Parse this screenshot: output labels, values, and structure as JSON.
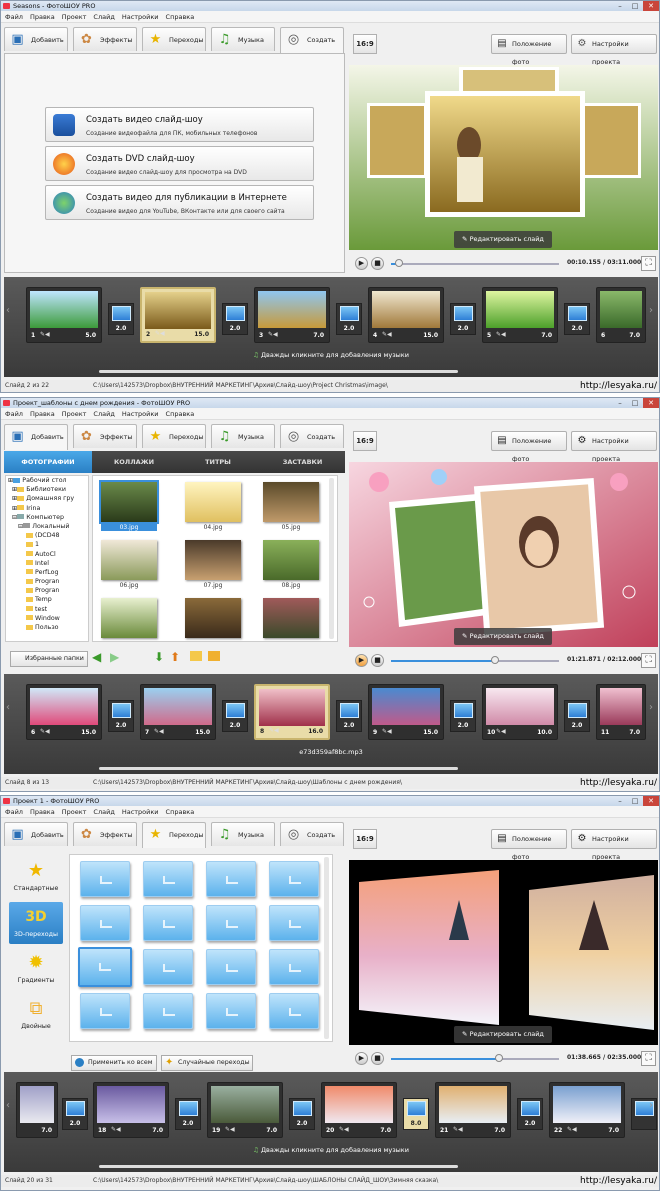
{
  "watermark": "http://lesyaka.ru/",
  "common": {
    "menu": [
      "Файл",
      "Правка",
      "Проект",
      "Слайд",
      "Настройки",
      "Справка"
    ],
    "tabs": [
      "Добавить",
      "Эффекты",
      "Переходы",
      "Музыка",
      "Создать"
    ],
    "ratio": "16:9",
    "photo_pos": "Положение фото",
    "project_settings": "Настройки проекта",
    "edit_slide": "Редактировать слайд",
    "audio_hint": "Дважды кликните для добавления музыки"
  },
  "win1": {
    "title": "Seasons - ФотоШОУ PRO",
    "active_tab": "Создать",
    "buttons": [
      {
        "title": "Создать видео слайд-шоу",
        "sub": "Создание видеофайла для ПК, мобильных телефонов"
      },
      {
        "title": "Создать DVD слайд-шоу",
        "sub": "Создание видео слайд-шоу для просмотра на DVD"
      },
      {
        "title": "Создать видео для публикации в Интернете",
        "sub": "Создание видео для YouTube, ВКонтакте или для своего сайта"
      }
    ],
    "time": "00:10.155 / 03:11.000",
    "progress": 0.05,
    "slides": [
      {
        "n": "1",
        "d": "5.0"
      },
      {
        "n": "2",
        "d": "15.0"
      },
      {
        "n": "3",
        "d": "7.0"
      },
      {
        "n": "4",
        "d": "15.0"
      },
      {
        "n": "5",
        "d": "7.0"
      },
      {
        "n": "6",
        "d": "7.0"
      }
    ],
    "trans": [
      "2.0",
      "2.0",
      "2.0",
      "2.0",
      "2.0"
    ],
    "status": "Слайд 2 из 22",
    "path": "C:\\Users\\142573\\Dropbox\\ВНУТРЕННИЙ МАРКЕТИНГ\\Архив\\Слайд-шоу\\Project Christmas\\image\\"
  },
  "win2": {
    "title": "Проект_шаблоны с днем рождения - ФотоШОУ PRO",
    "subtabs": [
      "ФОТОГРАФИИ",
      "КОЛЛАЖИ",
      "ТИТРЫ",
      "ЗАСТАВКИ"
    ],
    "tree": [
      "Рабочий стол",
      "Библиотеки",
      "Домашняя гру",
      "Irina",
      "Компьютер",
      "Локальный",
      "(DCD48",
      "1",
      "AutoCl",
      "Intel",
      "PerfLog",
      "Progran",
      "Progran",
      "Temp",
      "test",
      "Window",
      "Пользо"
    ],
    "files": [
      "03.jpg",
      "04.jpg",
      "05.jpg",
      "06.jpg",
      "07.jpg",
      "08.jpg",
      "",
      "",
      ""
    ],
    "favorites": "Избранные папки",
    "time": "01:21.871 / 02:12.000",
    "progress": 0.62,
    "slides": [
      {
        "n": "6",
        "d": "15.0"
      },
      {
        "n": "7",
        "d": "15.0"
      },
      {
        "n": "8",
        "d": "16.0"
      },
      {
        "n": "9",
        "d": "15.0"
      },
      {
        "n": "10",
        "d": "10.0"
      },
      {
        "n": "11",
        "d": "7.0"
      }
    ],
    "trans": [
      "2.0",
      "2.0",
      "2.0",
      "2.0",
      "2.0"
    ],
    "audio": "e73d359af8bc.mp3",
    "status": "Слайд 8 из 13",
    "path": "C:\\Users\\142573\\Dropbox\\ВНУТРЕННИЙ МАРКЕТИНГ\\Архив\\Слайд-шоу\\Шаблоны с днем рождения\\"
  },
  "win3": {
    "title": "Проект 1 - ФотоШОУ PRO",
    "categories": [
      "Стандартные",
      "3D-переходы",
      "Градиенты",
      "Двойные"
    ],
    "apply_all": "Применить ко всем",
    "random": "Случайные переходы",
    "time": "01:38.665 / 02:35.000",
    "progress": 0.64,
    "slides": [
      {
        "n": "",
        "d": "7.0"
      },
      {
        "n": "18",
        "d": "7.0"
      },
      {
        "n": "19",
        "d": "7.0"
      },
      {
        "n": "20",
        "d": "7.0"
      },
      {
        "n": "21",
        "d": "7.0"
      },
      {
        "n": "22",
        "d": "7.0"
      }
    ],
    "trans": [
      "2.0",
      "2.0",
      "2.0",
      "8.0",
      "2.0"
    ],
    "status": "Слайд 20 из 31",
    "path": "C:\\Users\\142573\\Dropbox\\ВНУТРЕННИЙ МАРКЕТИНГ\\Архив\\Слайд-шоу\\ШАБЛОНЫ СЛАЙД_ШОУ\\Зимняя сказка\\"
  }
}
